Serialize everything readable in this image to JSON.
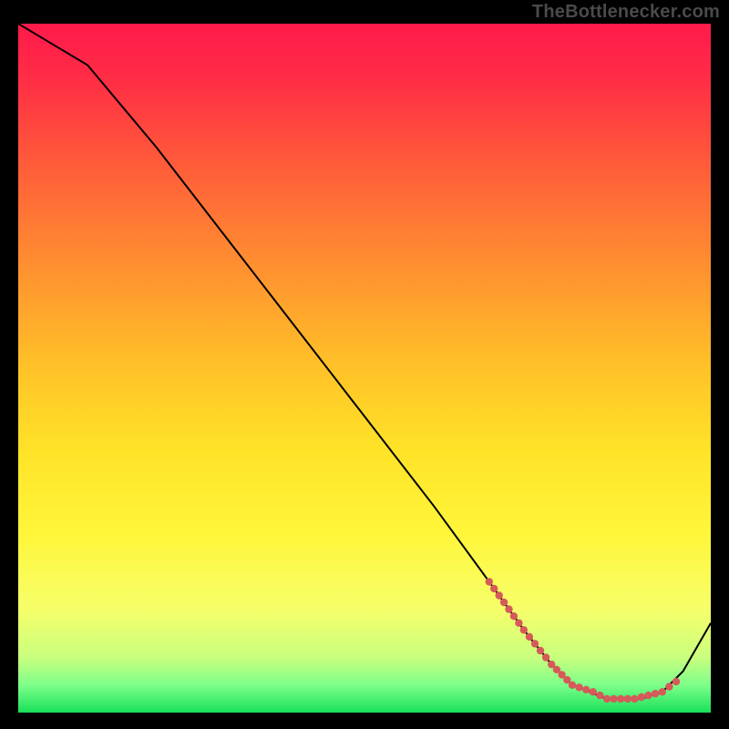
{
  "watermark": "TheBottlenecker.com",
  "chart_data": {
    "type": "line",
    "title": "",
    "xlabel": "",
    "ylabel": "",
    "xlim": [
      0,
      100
    ],
    "ylim": [
      0,
      100
    ],
    "gradient_stops": [
      {
        "offset": 0.0,
        "color": "#ff1a4b"
      },
      {
        "offset": 0.08,
        "color": "#ff2d45"
      },
      {
        "offset": 0.2,
        "color": "#ff5a3a"
      },
      {
        "offset": 0.35,
        "color": "#ff8f30"
      },
      {
        "offset": 0.5,
        "color": "#ffc228"
      },
      {
        "offset": 0.62,
        "color": "#ffe328"
      },
      {
        "offset": 0.74,
        "color": "#fff63a"
      },
      {
        "offset": 0.85,
        "color": "#f6ff6a"
      },
      {
        "offset": 0.92,
        "color": "#c9ff7e"
      },
      {
        "offset": 0.96,
        "color": "#7dff8a"
      },
      {
        "offset": 1.0,
        "color": "#19e05a"
      }
    ],
    "series": [
      {
        "name": "curve",
        "x": [
          0,
          5,
          10,
          20,
          30,
          40,
          50,
          60,
          68,
          73,
          77,
          80,
          85,
          90,
          93,
          96,
          100
        ],
        "y": [
          100,
          97,
          94,
          82,
          69,
          56,
          43,
          30,
          19,
          12,
          7,
          4,
          2,
          2,
          3,
          6,
          13
        ]
      }
    ],
    "dotted_segment": {
      "comment": "salmon dotted overlay along the trough of the curve",
      "x": [
        68,
        73,
        77,
        80,
        83,
        85,
        87,
        89,
        91,
        93,
        95
      ],
      "y": [
        19,
        12,
        7,
        4,
        3,
        2,
        2,
        2,
        2.5,
        3,
        4.5
      ]
    },
    "colors": {
      "curve": "#000000",
      "dots": "#d65a5a",
      "frame_bg": "#000000"
    }
  }
}
